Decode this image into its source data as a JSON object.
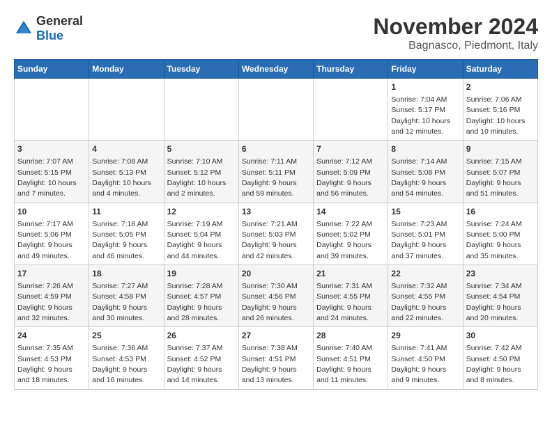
{
  "header": {
    "logo_general": "General",
    "logo_blue": "Blue",
    "month": "November 2024",
    "location": "Bagnasco, Piedmont, Italy"
  },
  "weekdays": [
    "Sunday",
    "Monday",
    "Tuesday",
    "Wednesday",
    "Thursday",
    "Friday",
    "Saturday"
  ],
  "weeks": [
    [
      {
        "day": "",
        "info": ""
      },
      {
        "day": "",
        "info": ""
      },
      {
        "day": "",
        "info": ""
      },
      {
        "day": "",
        "info": ""
      },
      {
        "day": "",
        "info": ""
      },
      {
        "day": "1",
        "info": "Sunrise: 7:04 AM\nSunset: 5:17 PM\nDaylight: 10 hours and 12 minutes."
      },
      {
        "day": "2",
        "info": "Sunrise: 7:06 AM\nSunset: 5:16 PM\nDaylight: 10 hours and 10 minutes."
      }
    ],
    [
      {
        "day": "3",
        "info": "Sunrise: 7:07 AM\nSunset: 5:15 PM\nDaylight: 10 hours and 7 minutes."
      },
      {
        "day": "4",
        "info": "Sunrise: 7:08 AM\nSunset: 5:13 PM\nDaylight: 10 hours and 4 minutes."
      },
      {
        "day": "5",
        "info": "Sunrise: 7:10 AM\nSunset: 5:12 PM\nDaylight: 10 hours and 2 minutes."
      },
      {
        "day": "6",
        "info": "Sunrise: 7:11 AM\nSunset: 5:11 PM\nDaylight: 9 hours and 59 minutes."
      },
      {
        "day": "7",
        "info": "Sunrise: 7:12 AM\nSunset: 5:09 PM\nDaylight: 9 hours and 56 minutes."
      },
      {
        "day": "8",
        "info": "Sunrise: 7:14 AM\nSunset: 5:08 PM\nDaylight: 9 hours and 54 minutes."
      },
      {
        "day": "9",
        "info": "Sunrise: 7:15 AM\nSunset: 5:07 PM\nDaylight: 9 hours and 51 minutes."
      }
    ],
    [
      {
        "day": "10",
        "info": "Sunrise: 7:17 AM\nSunset: 5:06 PM\nDaylight: 9 hours and 49 minutes."
      },
      {
        "day": "11",
        "info": "Sunrise: 7:18 AM\nSunset: 5:05 PM\nDaylight: 9 hours and 46 minutes."
      },
      {
        "day": "12",
        "info": "Sunrise: 7:19 AM\nSunset: 5:04 PM\nDaylight: 9 hours and 44 minutes."
      },
      {
        "day": "13",
        "info": "Sunrise: 7:21 AM\nSunset: 5:03 PM\nDaylight: 9 hours and 42 minutes."
      },
      {
        "day": "14",
        "info": "Sunrise: 7:22 AM\nSunset: 5:02 PM\nDaylight: 9 hours and 39 minutes."
      },
      {
        "day": "15",
        "info": "Sunrise: 7:23 AM\nSunset: 5:01 PM\nDaylight: 9 hours and 37 minutes."
      },
      {
        "day": "16",
        "info": "Sunrise: 7:24 AM\nSunset: 5:00 PM\nDaylight: 9 hours and 35 minutes."
      }
    ],
    [
      {
        "day": "17",
        "info": "Sunrise: 7:26 AM\nSunset: 4:59 PM\nDaylight: 9 hours and 32 minutes."
      },
      {
        "day": "18",
        "info": "Sunrise: 7:27 AM\nSunset: 4:58 PM\nDaylight: 9 hours and 30 minutes."
      },
      {
        "day": "19",
        "info": "Sunrise: 7:28 AM\nSunset: 4:57 PM\nDaylight: 9 hours and 28 minutes."
      },
      {
        "day": "20",
        "info": "Sunrise: 7:30 AM\nSunset: 4:56 PM\nDaylight: 9 hours and 26 minutes."
      },
      {
        "day": "21",
        "info": "Sunrise: 7:31 AM\nSunset: 4:55 PM\nDaylight: 9 hours and 24 minutes."
      },
      {
        "day": "22",
        "info": "Sunrise: 7:32 AM\nSunset: 4:55 PM\nDaylight: 9 hours and 22 minutes."
      },
      {
        "day": "23",
        "info": "Sunrise: 7:34 AM\nSunset: 4:54 PM\nDaylight: 9 hours and 20 minutes."
      }
    ],
    [
      {
        "day": "24",
        "info": "Sunrise: 7:35 AM\nSunset: 4:53 PM\nDaylight: 9 hours and 18 minutes."
      },
      {
        "day": "25",
        "info": "Sunrise: 7:36 AM\nSunset: 4:53 PM\nDaylight: 9 hours and 16 minutes."
      },
      {
        "day": "26",
        "info": "Sunrise: 7:37 AM\nSunset: 4:52 PM\nDaylight: 9 hours and 14 minutes."
      },
      {
        "day": "27",
        "info": "Sunrise: 7:38 AM\nSunset: 4:51 PM\nDaylight: 9 hours and 13 minutes."
      },
      {
        "day": "28",
        "info": "Sunrise: 7:40 AM\nSunset: 4:51 PM\nDaylight: 9 hours and 11 minutes."
      },
      {
        "day": "29",
        "info": "Sunrise: 7:41 AM\nSunset: 4:50 PM\nDaylight: 9 hours and 9 minutes."
      },
      {
        "day": "30",
        "info": "Sunrise: 7:42 AM\nSunset: 4:50 PM\nDaylight: 9 hours and 8 minutes."
      }
    ]
  ]
}
